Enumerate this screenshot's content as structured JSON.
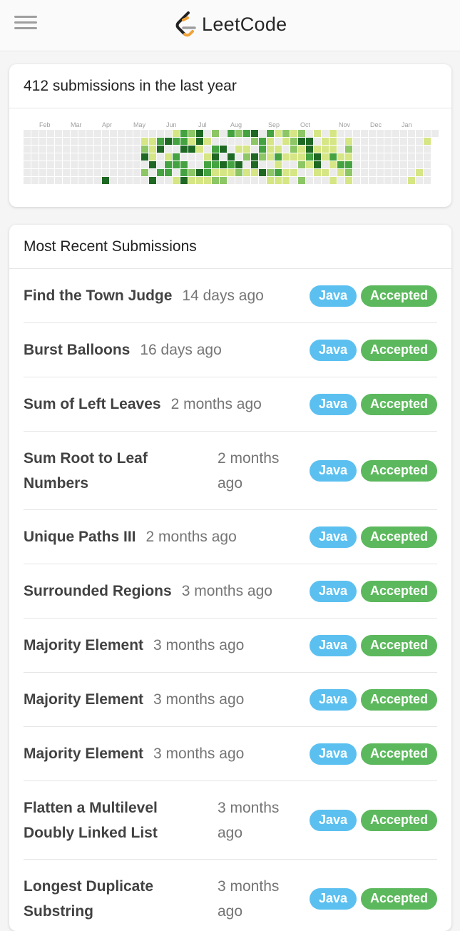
{
  "header": {
    "brand": "LeetCode"
  },
  "heatmap": {
    "title": "412 submissions in the last year",
    "months": [
      "Feb",
      "Mar",
      "Apr",
      "May",
      "Jun",
      "Jul",
      "Aug",
      "Sep",
      "Oct",
      "Nov",
      "Dec",
      "Jan"
    ],
    "colors": {
      "empty": "#ebebeb",
      "l1": "#d6e685",
      "l2": "#8cc665",
      "l3": "#44a340",
      "l4": "#1e6823"
    }
  },
  "recent": {
    "title": "Most Recent Submissions",
    "items": [
      {
        "title": "Find the Town Judge",
        "time": "14 days ago",
        "lang": "Java",
        "status": "Accepted"
      },
      {
        "title": "Burst Balloons",
        "time": "16 days ago",
        "lang": "Java",
        "status": "Accepted"
      },
      {
        "title": "Sum of Left Leaves",
        "time": "2 months ago",
        "lang": "Java",
        "status": "Accepted"
      },
      {
        "title": "Sum Root to Leaf Numbers",
        "time": "2 months ago",
        "lang": "Java",
        "status": "Accepted"
      },
      {
        "title": "Unique Paths III",
        "time": "2 months ago",
        "lang": "Java",
        "status": "Accepted"
      },
      {
        "title": "Surrounded Regions",
        "time": "3 months ago",
        "lang": "Java",
        "status": "Accepted"
      },
      {
        "title": "Majority Element",
        "time": "3 months ago",
        "lang": "Java",
        "status": "Accepted"
      },
      {
        "title": "Majority Element",
        "time": "3 months ago",
        "lang": "Java",
        "status": "Accepted"
      },
      {
        "title": "Majority Element",
        "time": "3 months ago",
        "lang": "Java",
        "status": "Accepted"
      },
      {
        "title": "Flatten a Multilevel Doubly Linked List",
        "time": "3 months ago",
        "lang": "Java",
        "status": "Accepted"
      },
      {
        "title": "Longest Duplicate Substring",
        "time": "3 months ago",
        "lang": "Java",
        "status": "Accepted"
      }
    ]
  }
}
